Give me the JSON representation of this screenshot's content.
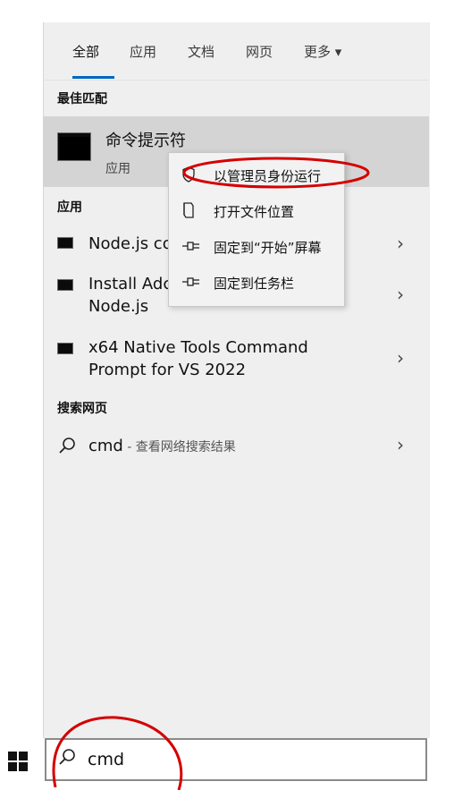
{
  "tabs": [
    {
      "label": "全部"
    },
    {
      "label": "应用"
    },
    {
      "label": "文档"
    },
    {
      "label": "网页"
    },
    {
      "label": "更多 ▾"
    }
  ],
  "best_match": {
    "heading": "最佳匹配",
    "title": "命令提示符",
    "subtitle": "应用"
  },
  "apps": {
    "heading": "应用",
    "items": [
      {
        "label": "Node.js co"
      },
      {
        "label_line1": "Install Adc",
        "label_line2": "Node.js"
      },
      {
        "label_line1": "x64 Native Tools Command",
        "label_line2": "Prompt for VS 2022"
      }
    ]
  },
  "web": {
    "heading": "搜索网页",
    "query": "cmd",
    "suffix": " - 查看网络搜索结果"
  },
  "context_menu": {
    "items": [
      {
        "label": "以管理员身份运行",
        "icon": "shield-icon"
      },
      {
        "label": "打开文件位置",
        "icon": "folder-icon"
      },
      {
        "label": "固定到“开始”屏幕",
        "icon": "pin-icon"
      },
      {
        "label": "固定到任务栏",
        "icon": "pin-icon"
      }
    ]
  },
  "search": {
    "value": "cmd"
  },
  "colors": {
    "accent": "#0067c0",
    "annotation": "#d40000"
  }
}
